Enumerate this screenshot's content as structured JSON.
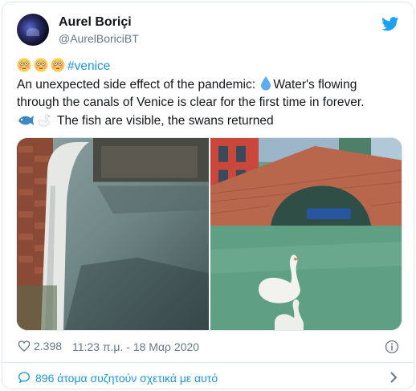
{
  "tweet": {
    "author": {
      "display_name": "Aurel Boriçi",
      "handle": "@AurelBoriciBT"
    },
    "text": {
      "hashtag": "#venice",
      "line2": "An unexpected side effect of the pandemic: ",
      "line2b": "Water's flowing",
      "line3": "through the canals of Venice is clear for the first time in forever.",
      "line4": "The fish are visible, the swans returned"
    },
    "icons": [
      "flushed-face-emoji",
      "droplet-emoji",
      "fish-emoji",
      "swan-emoji",
      "twitter-bird-icon",
      "heart-icon",
      "info-icon",
      "speech-bubble-icon",
      "chevron-right-icon"
    ],
    "likes": "2.398",
    "timestamp": "11:23 π.μ. - 18 Μαρ 2020",
    "conversation": "896 άτομα συζητούν σχετικά με αυτό"
  },
  "colors": {
    "accent": "#1b95e0",
    "text": "#14171a",
    "muted": "#657786",
    "border": "#e1e8ed"
  }
}
